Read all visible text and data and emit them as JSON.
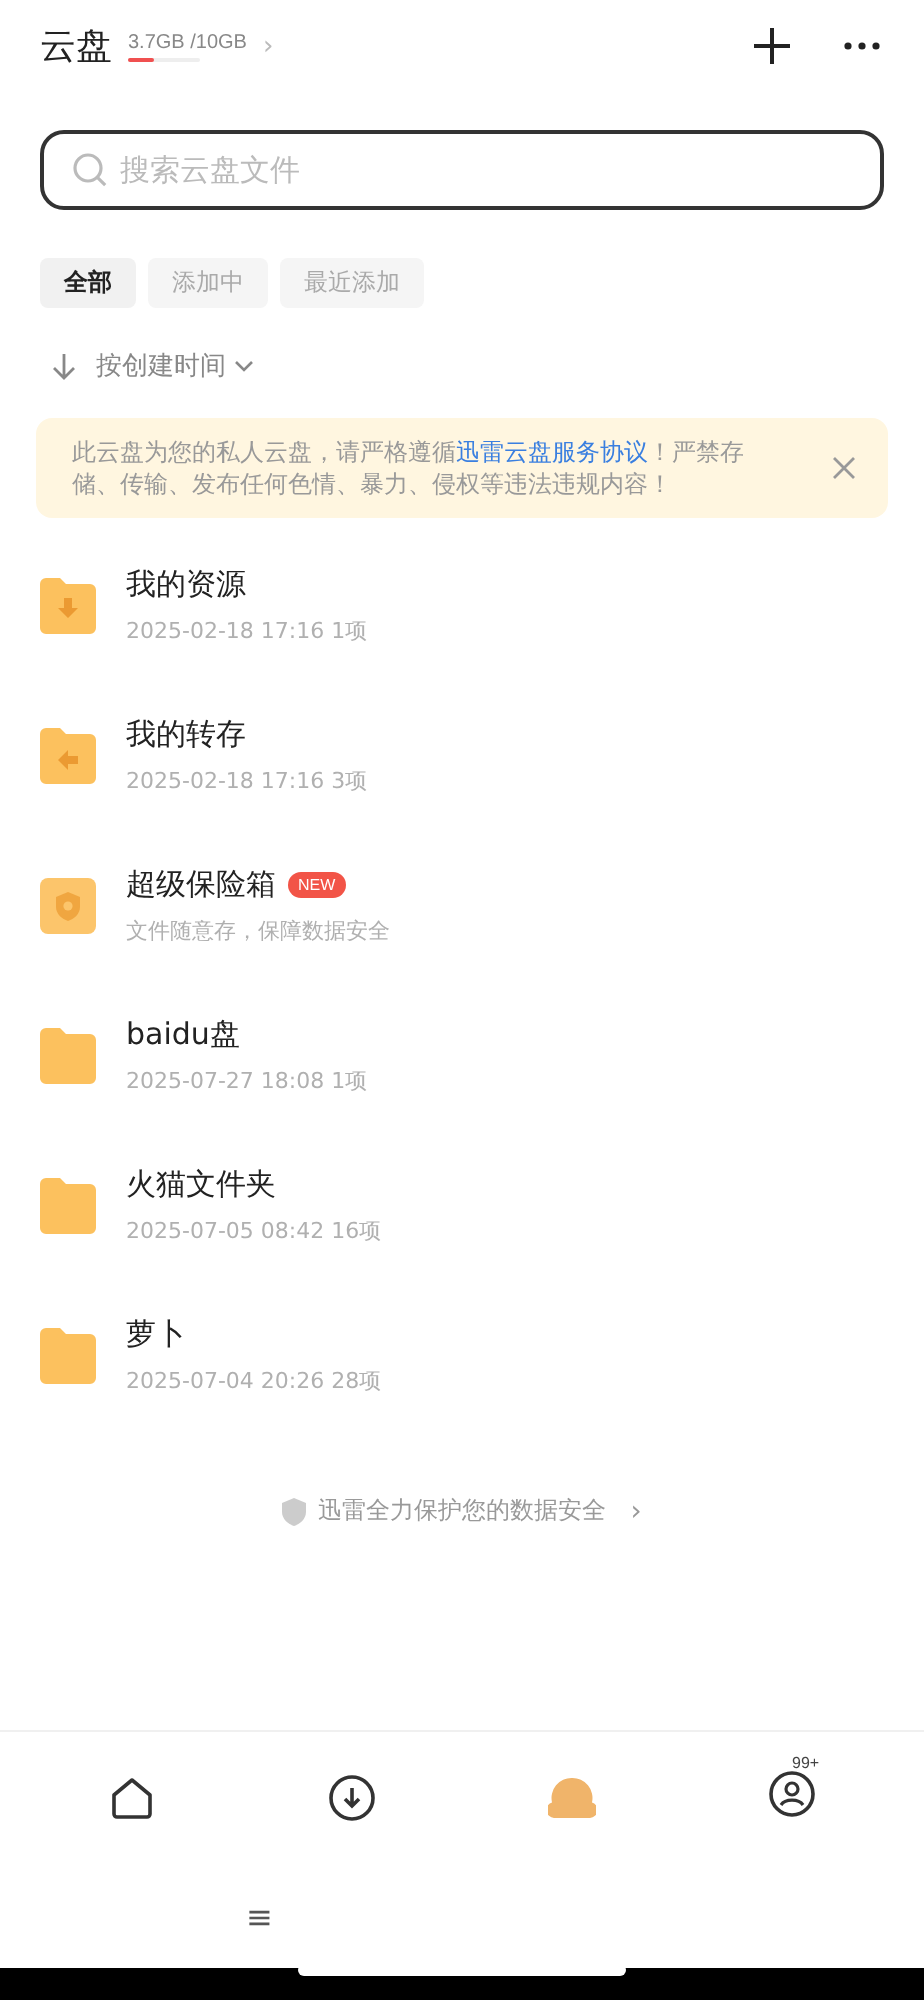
{
  "header": {
    "title": "云盘",
    "storage": "3.7GB /10GB",
    "level": 0.37,
    "arrow": "›"
  },
  "search": {
    "placeholder": "搜索云盘文件"
  },
  "tabs": [
    {
      "label": "全部",
      "selected": true
    },
    {
      "label": "添加中",
      "selected": false
    },
    {
      "label": "最近添加",
      "selected": false
    }
  ],
  "sort": {
    "label": "按创建时间"
  },
  "notice": {
    "text": "此云盘为您的私人云盘，请严格遵循",
    "link": "迅雷云盘服务协议",
    "text_after": "！严禁存储、传输、发布任何色情、暴力、侵权等违法违规内容！"
  },
  "files": [
    {
      "kind": "download",
      "name": "我的资源",
      "meta": "2025-02-18 17:16 1项"
    },
    {
      "kind": "transfer",
      "name": "我的转存",
      "meta": "2025-02-18 17:16 3项"
    },
    {
      "kind": "safe",
      "name": "超级保险箱",
      "badge": "NEW",
      "meta": "文件随意存，保障数据安全"
    },
    {
      "kind": "folder",
      "name": "baidu盘",
      "meta": "2025-07-27 18:08 1项"
    },
    {
      "kind": "folder",
      "name": "火猫文件夹",
      "meta": "2025-07-05 08:42 16项"
    },
    {
      "kind": "folder",
      "name": "萝卜",
      "meta": "2025-07-04 20:26 28项"
    }
  ],
  "footer": {
    "text": "迅雷全力保护您的数据安全",
    "arrow": "›"
  },
  "nav": [
    {
      "kind": "home"
    },
    {
      "kind": "download"
    },
    {
      "kind": "cloud",
      "selected": true
    },
    {
      "kind": "profile",
      "badge": "99+"
    }
  ],
  "system_nav": {
    "menu": "≡"
  }
}
